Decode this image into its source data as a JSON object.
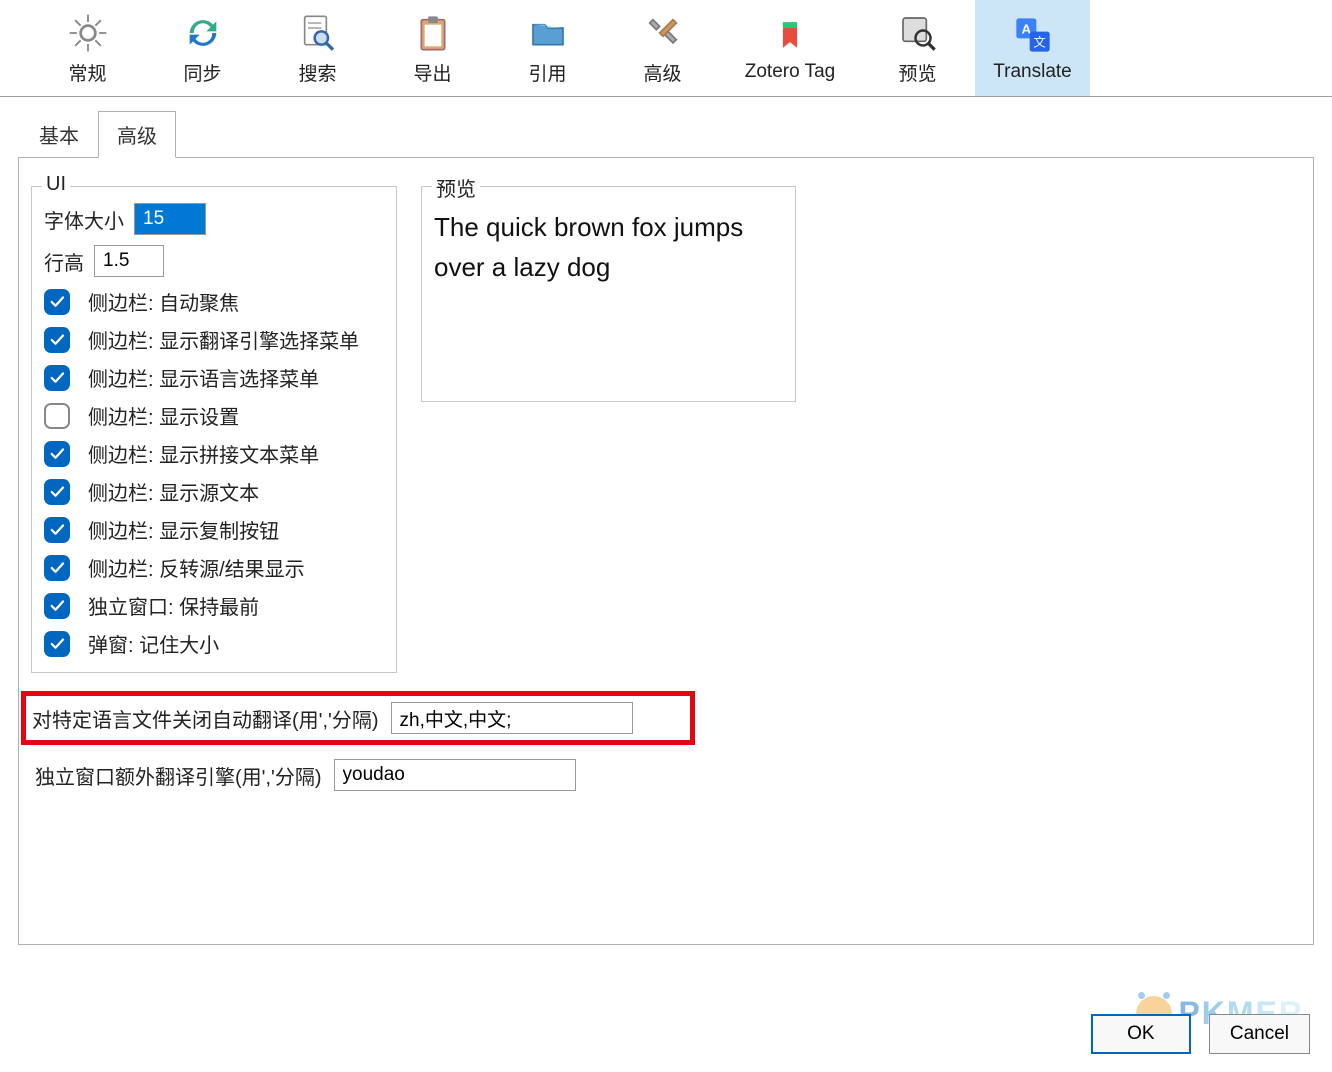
{
  "toolbar": [
    {
      "id": "general",
      "label": "常规"
    },
    {
      "id": "sync",
      "label": "同步"
    },
    {
      "id": "search",
      "label": "搜索"
    },
    {
      "id": "export",
      "label": "导出"
    },
    {
      "id": "cite",
      "label": "引用"
    },
    {
      "id": "advanced",
      "label": "高级"
    },
    {
      "id": "zoterotag",
      "label": "Zotero Tag"
    },
    {
      "id": "preview",
      "label": "预览"
    },
    {
      "id": "translate",
      "label": "Translate",
      "active": true
    }
  ],
  "tabs": [
    {
      "id": "basic",
      "label": "基本"
    },
    {
      "id": "advanced",
      "label": "高级",
      "active": true
    }
  ],
  "ui_group": {
    "legend": "UI",
    "font_size_label": "字体大小",
    "font_size_value": "15",
    "line_height_label": "行高",
    "line_height_value": "1.5",
    "checks": [
      {
        "checked": true,
        "label": "侧边栏: 自动聚焦"
      },
      {
        "checked": true,
        "label": "侧边栏: 显示翻译引擎选择菜单"
      },
      {
        "checked": true,
        "label": "侧边栏: 显示语言选择菜单"
      },
      {
        "checked": false,
        "label": "侧边栏: 显示设置"
      },
      {
        "checked": true,
        "label": "侧边栏: 显示拼接文本菜单"
      },
      {
        "checked": true,
        "label": "侧边栏: 显示源文本"
      },
      {
        "checked": true,
        "label": "侧边栏: 显示复制按钮"
      },
      {
        "checked": true,
        "label": "侧边栏: 反转源/结果显示"
      },
      {
        "checked": true,
        "label": "独立窗口: 保持最前"
      },
      {
        "checked": true,
        "label": "弹窗: 记住大小"
      }
    ]
  },
  "preview_group": {
    "legend": "预览",
    "text": "The quick brown fox jumps over a lazy dog"
  },
  "bottom": {
    "disable_langs_label": "对特定语言文件关闭自动翻译(用','分隔)",
    "disable_langs_value": "zh,中文,中文;",
    "extra_engines_label": "独立窗口额外翻译引擎(用','分隔)",
    "extra_engines_value": "youdao"
  },
  "buttons": {
    "ok": "OK",
    "cancel": "Cancel"
  },
  "watermark": "PKMER"
}
